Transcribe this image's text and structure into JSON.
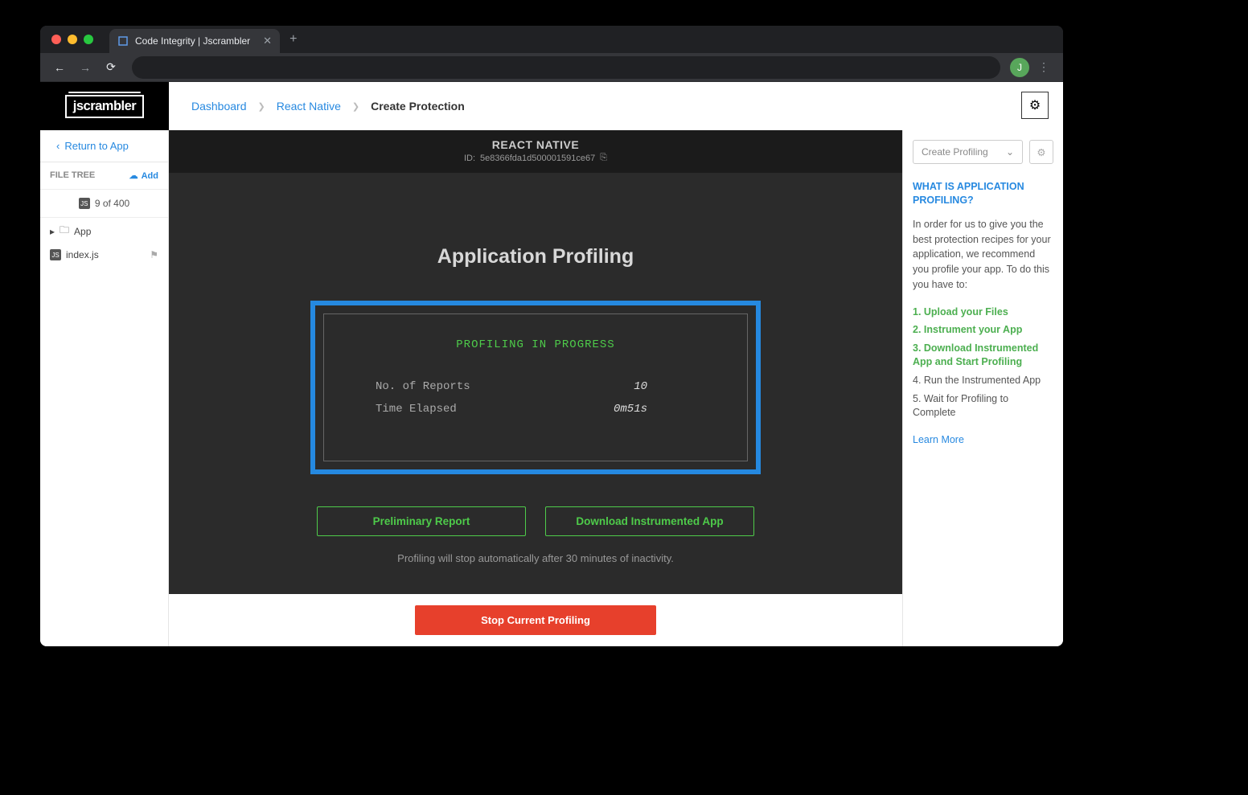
{
  "browser": {
    "tab_title": "Code Integrity | Jscrambler",
    "avatar_letter": "J"
  },
  "logo_text": "jscrambler",
  "breadcrumb": {
    "dashboard": "Dashboard",
    "app": "React Native",
    "current": "Create Protection"
  },
  "sidebar_left": {
    "return": "Return to App",
    "file_tree_label": "FILE TREE",
    "add_label": "Add",
    "file_count": "9 of 400",
    "folder": "App",
    "file": "index.js"
  },
  "title_bar": {
    "name": "REACT NATIVE",
    "id_label": "ID:",
    "id": "5e8366fda1d500001591ce67"
  },
  "profiling": {
    "heading": "Application Profiling",
    "status": "PROFILING IN PROGRESS",
    "reports_label": "No. of Reports",
    "reports_value": "10",
    "elapsed_label": "Time Elapsed",
    "elapsed_value": "0m51s",
    "preliminary_btn": "Preliminary Report",
    "download_btn": "Download Instrumented App",
    "auto_stop_hint": "Profiling will stop automatically after 30 minutes of inactivity.",
    "stop_btn": "Stop Current Profiling"
  },
  "sidebar_right": {
    "dropdown_label": "Create Profiling",
    "heading": "WHAT IS APPLICATION PROFILING?",
    "intro": "In order for us to give you the best protection recipes for your application, we recommend you profile your app. To do this you have to:",
    "steps": [
      "1. Upload your Files",
      "2. Instrument your App",
      "3. Download Instrumented App and Start Profiling",
      "4. Run the Instrumented App",
      "5. Wait for Profiling to Complete"
    ],
    "learn_more": "Learn More"
  }
}
